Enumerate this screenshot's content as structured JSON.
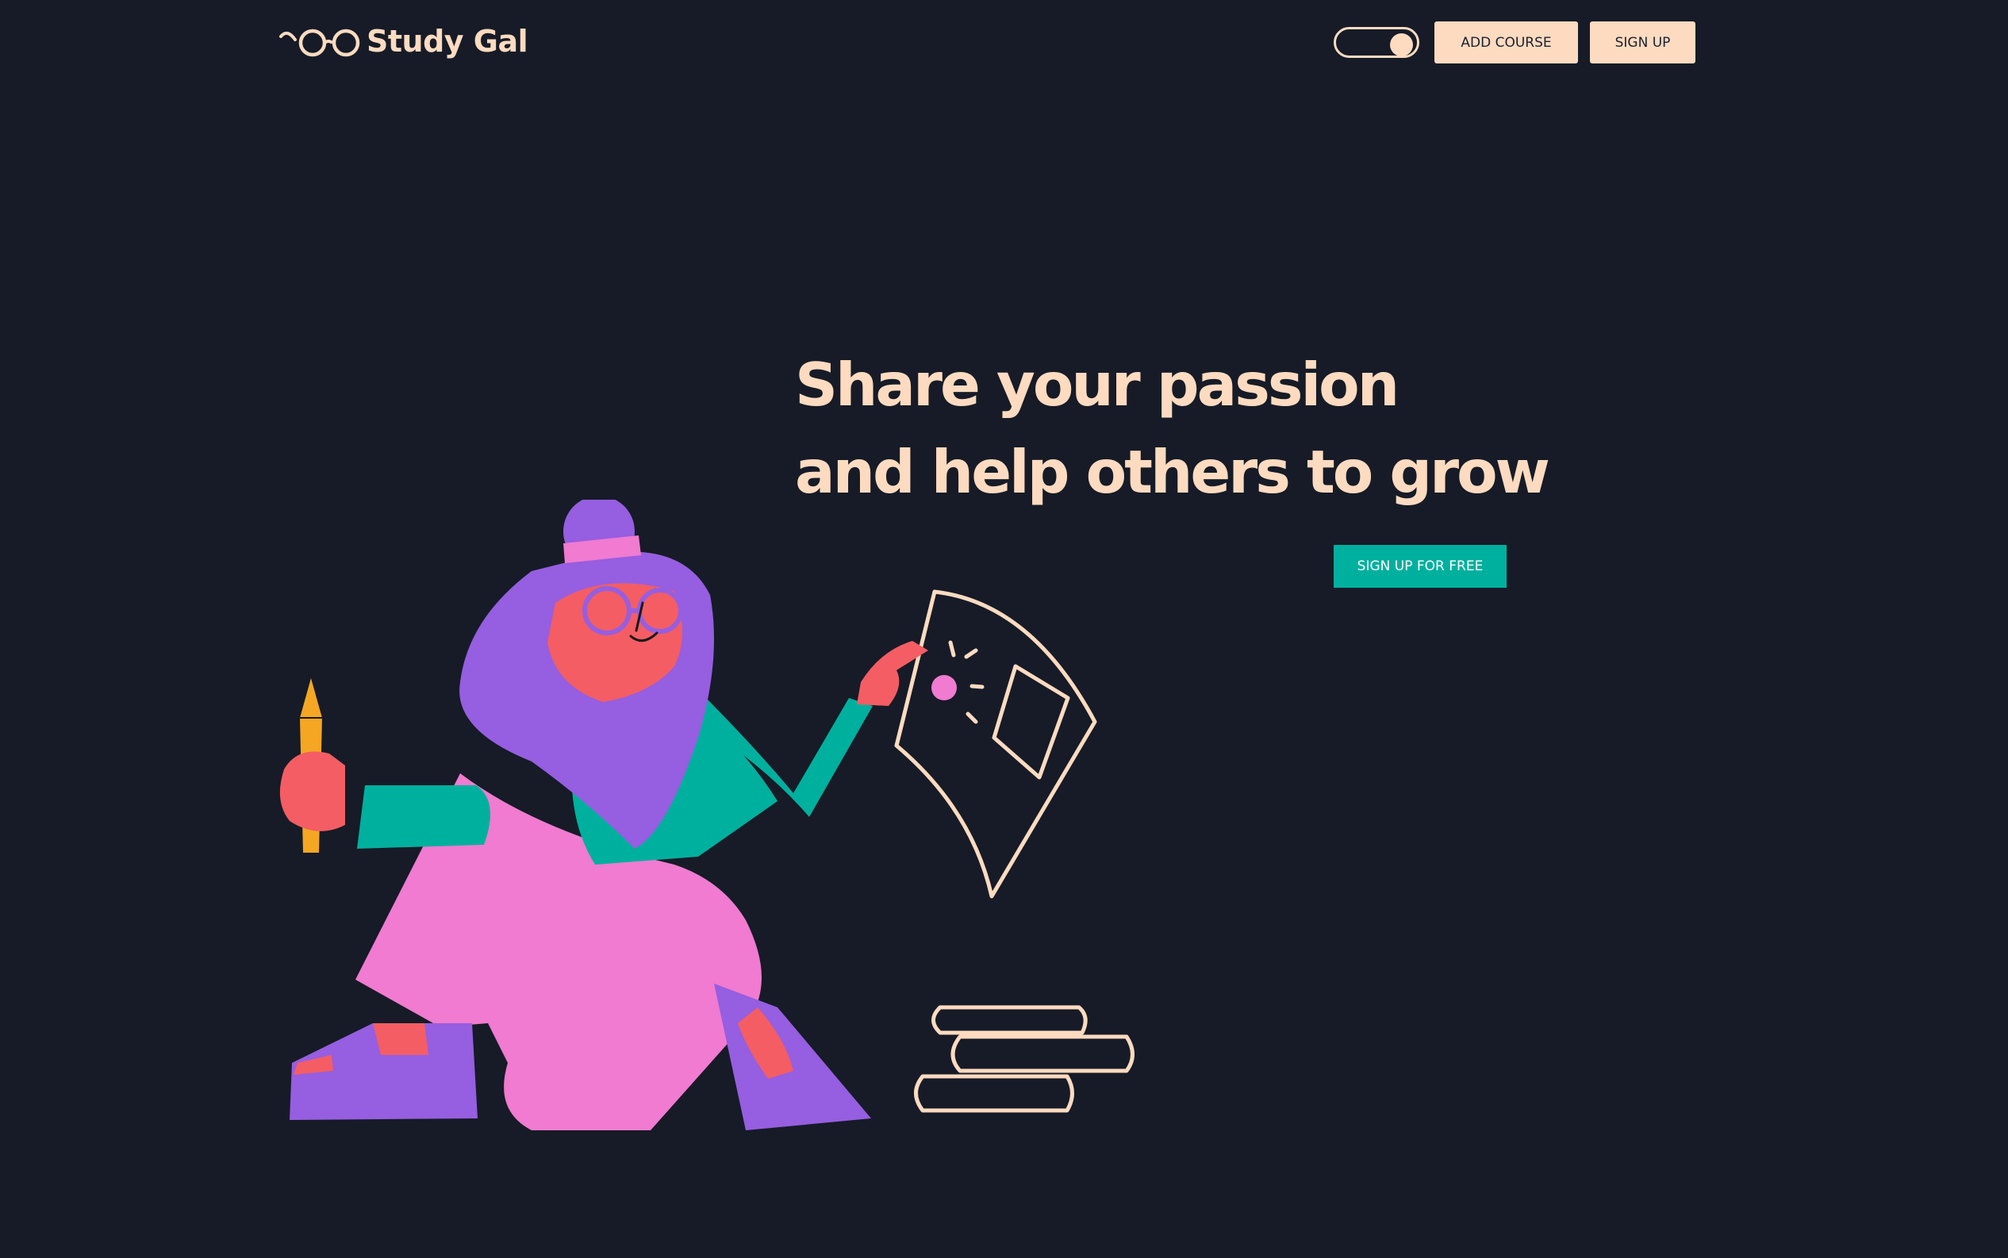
{
  "brand": {
    "name": "Study Gal"
  },
  "nav": {
    "theme_toggle": {
      "state": "on"
    },
    "add_course_label": "ADD COURSE",
    "sign_up_label": "SIGN UP"
  },
  "hero": {
    "title_line1": "Share your passion",
    "title_line2": "and help others to grow",
    "cta_label": "SIGN UP FOR FREE"
  },
  "colors": {
    "background": "#161b27",
    "accent_peach": "#fddbc0",
    "cta_teal": "#00b09e"
  },
  "icons": [
    "glasses-logo-icon",
    "theme-toggle",
    "woman-with-pencil-illustration"
  ]
}
